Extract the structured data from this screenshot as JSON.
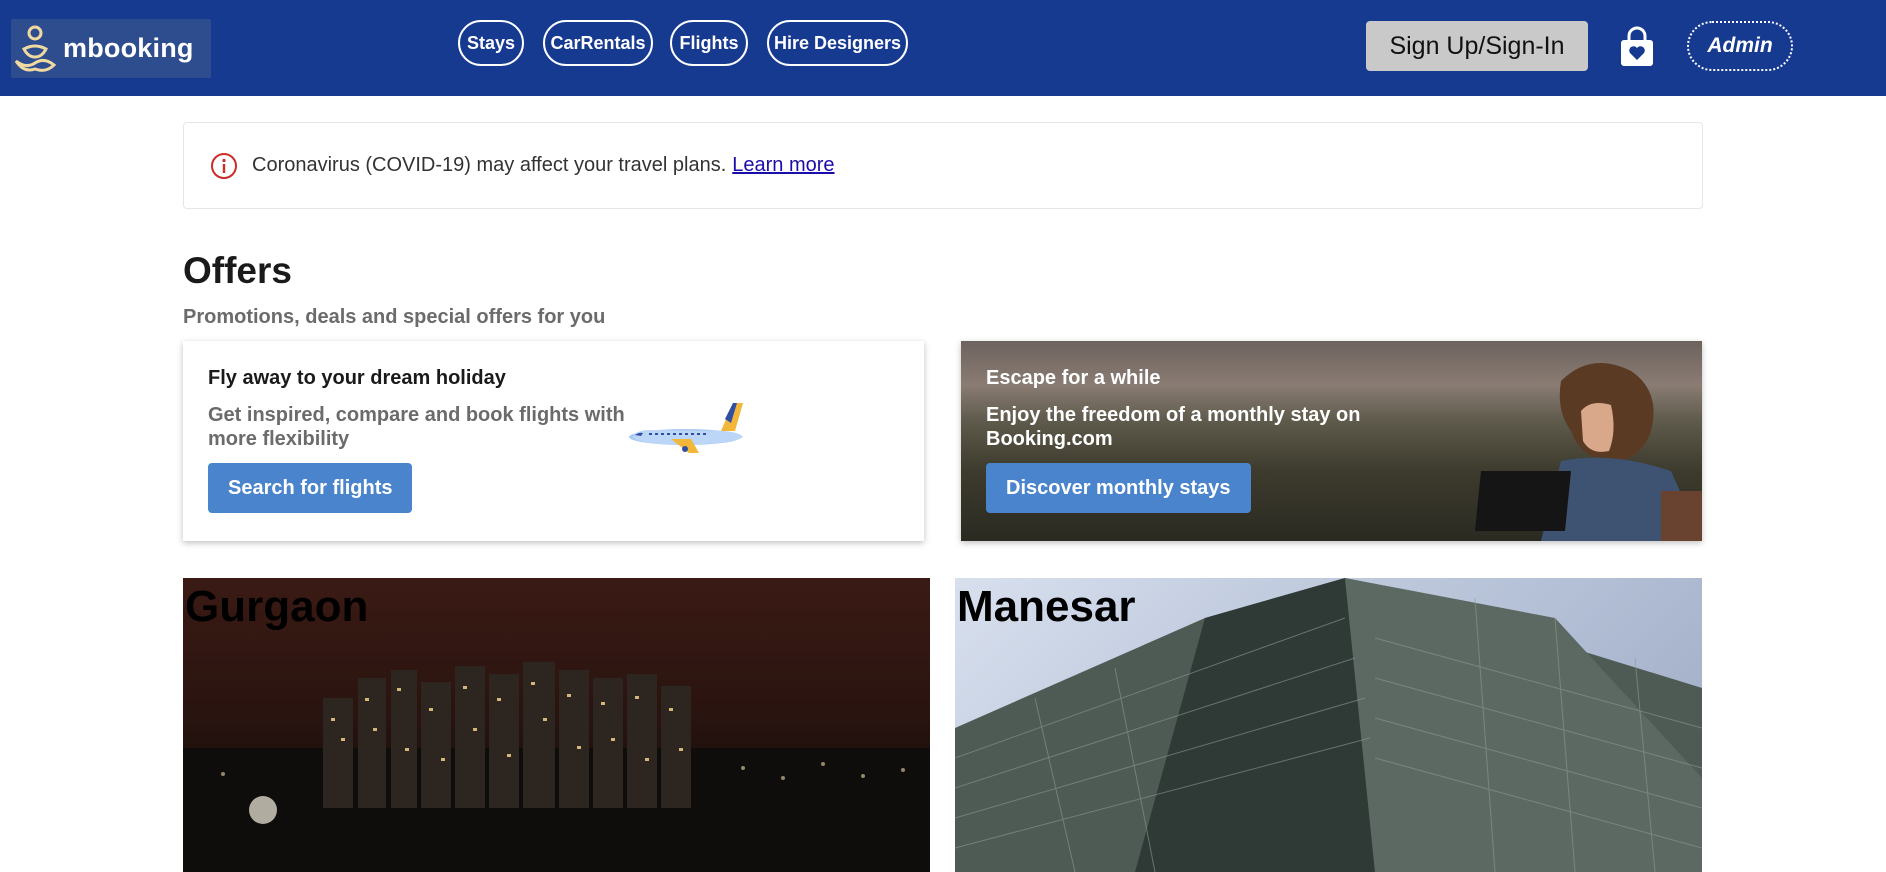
{
  "header": {
    "brand": "mbooking",
    "nav": [
      "Stays",
      "CarRentals",
      "Flights",
      "Hire Designers"
    ],
    "signin_label": "Sign Up/Sign-In",
    "admin_label": "Admin",
    "colors": {
      "bar": "#173a91",
      "signin_bg": "#c9c9c9"
    }
  },
  "notice": {
    "text": "Coronavirus (COVID-19) may affect your travel plans.",
    "link": "Learn more",
    "icon": "info-icon"
  },
  "offers": {
    "title": "Offers",
    "subtitle": "Promotions, deals and special offers for you",
    "cards": [
      {
        "title": "Fly away to your dream holiday",
        "description": "Get inspired, compare and book flights with more flexibility",
        "button": "Search for flights"
      },
      {
        "title": "Escape for a while",
        "description": "Enjoy the freedom of a monthly stay on Booking.com",
        "button": "Discover monthly stays"
      }
    ]
  },
  "cities": [
    "Gurgaon",
    "Manesar"
  ],
  "colors": {
    "accent_button": "#4a84cc",
    "link": "#1a0dab",
    "notice_icon": "#cc2b2b"
  }
}
